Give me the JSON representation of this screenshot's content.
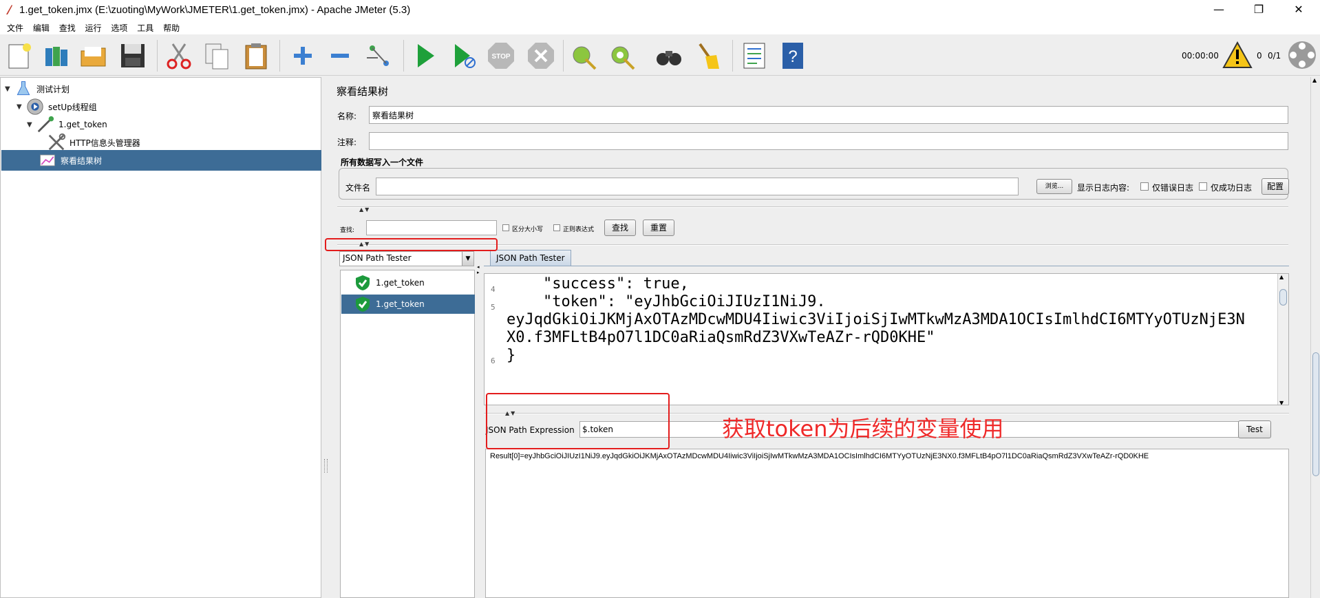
{
  "window": {
    "title": "1.get_token.jmx (E:\\zuoting\\MyWork\\JMETER\\1.get_token.jmx) - Apache JMeter (5.3)",
    "minimize": "—",
    "restore": "❐",
    "close": "✕"
  },
  "menu": [
    "文件",
    "编辑",
    "查找",
    "运行",
    "选项",
    "工具",
    "帮助"
  ],
  "toolbar": {
    "icons": [
      "new-icon",
      "templates-icon",
      "open-icon",
      "save-icon",
      "cut-icon",
      "copy-icon",
      "paste-icon",
      "expand-icon",
      "collapse-icon",
      "toggle-icon",
      "start-icon",
      "start-no-pause-icon",
      "stop-icon",
      "shutdown-icon",
      "clear-icon",
      "clear-all-icon",
      "search-icon",
      "reset-search-icon",
      "function-helper-icon",
      "help-icon"
    ],
    "timer": "00:00:00",
    "error_count": "0",
    "thread_count": "0/1",
    "stop_label": "STOP"
  },
  "tree": {
    "nodes": [
      {
        "label": "测试计划",
        "icon": "test-plan-icon"
      },
      {
        "label": "setUp线程组",
        "icon": "thread-group-icon"
      },
      {
        "label": "1.get_token",
        "icon": "sampler-icon"
      },
      {
        "label": "HTTP信息头管理器",
        "icon": "header-manager-icon"
      },
      {
        "label": "察看结果树",
        "icon": "results-tree-icon"
      }
    ]
  },
  "panel": {
    "heading": "察看结果树",
    "name_label": "名称:",
    "name_value": "察看结果树",
    "comment_label": "注释:",
    "comment_value": "",
    "file_group_title": "所有数据写入一个文件",
    "filename_label": "文件名",
    "filename_value": "",
    "browse_button": "浏览...",
    "log_content_label": "显示日志内容:",
    "errors_only": "仅错误日志",
    "success_only": "仅成功日志",
    "configure_button": "配置",
    "search_label": "查找:",
    "search_value": "",
    "case_sensitive": "区分大小写",
    "regex": "正则表达式",
    "find_button": "查找",
    "reset_button": "重置"
  },
  "renderer": {
    "selected": "JSON Path Tester"
  },
  "results": [
    {
      "label": "1.get_token",
      "status": "success"
    },
    {
      "label": "1.get_token",
      "status": "success"
    }
  ],
  "tab": {
    "label": "JSON Path Tester"
  },
  "code": {
    "lines": [
      {
        "no": "4",
        "text": "    \"success\": true,"
      },
      {
        "no": "5",
        "text": "    \"token\": \"eyJhbGciOiJIUzI1NiJ9."
      },
      {
        "no": "",
        "text": "eyJqdGkiOiJKMjAxOTAzMDcwMDU4Iiwic3ViIjoiSjIwMTkwMzA3MDA1OCIsImlhdCI6MTYyOTUzNjE3N"
      },
      {
        "no": "",
        "text": "X0.f3MFLtB4pO7l1DC0aRiaQsmRdZ3VXwTeAZr-rQD0KHE\""
      },
      {
        "no": "6",
        "text": "}"
      }
    ]
  },
  "jsonpath": {
    "label": "JSON Path Expression",
    "expression": "$.token",
    "test_button": "Test",
    "result": "Result[0]=eyJhbGciOiJIUzI1NiJ9.eyJqdGkiOiJKMjAxOTAzMDcwMDU4Iiwic3ViIjoiSjIwMTkwMzA3MDA1OCIsImlhdCI6MTYyOTUzNjE3NX0.f3MFLtB4pO7l1DC0aRiaQsmRdZ3VXwTeAZr-rQD0KHE"
  },
  "annotation": {
    "text": "获取token为后续的变量使用",
    "color": "#ef2a2a"
  },
  "colors": {
    "selection": "#3d6c96",
    "accent_red": "#e31c1c"
  }
}
